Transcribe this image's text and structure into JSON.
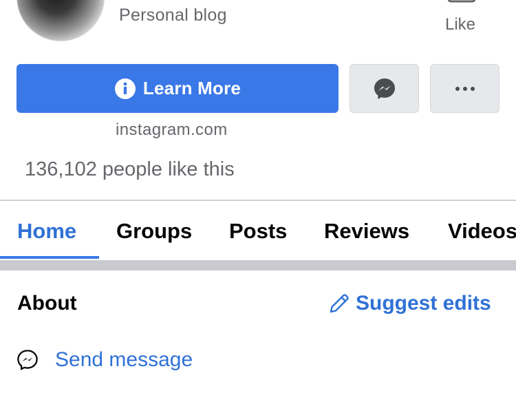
{
  "profile": {
    "category": "Personal blog",
    "like_label": "Like"
  },
  "actions": {
    "learn_more_label": "Learn More",
    "website": "instagram.com"
  },
  "likes_text": "136,102 people like this",
  "tabs": [
    {
      "label": "Home",
      "active": true
    },
    {
      "label": "Groups",
      "active": false
    },
    {
      "label": "Posts",
      "active": false
    },
    {
      "label": "Reviews",
      "active": false
    },
    {
      "label": "Videos",
      "active": false
    }
  ],
  "about": {
    "title": "About",
    "suggest_label": "Suggest edits",
    "send_message_label": "Send message"
  },
  "colors": {
    "primary_blue": "#3b78e7",
    "link_blue": "#2f71d6",
    "secondary_text": "#65676b",
    "button_gray": "#e7e8eb"
  }
}
